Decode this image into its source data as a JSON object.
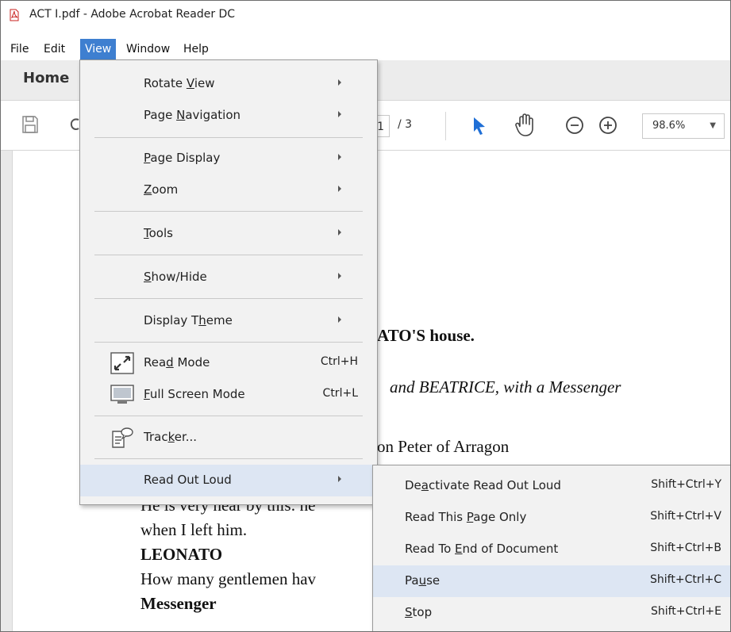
{
  "window": {
    "title": "ACT I.pdf - Adobe Acrobat Reader DC"
  },
  "menubar": {
    "file": "File",
    "edit": "Edit",
    "view": "View",
    "window": "Window",
    "help": "Help"
  },
  "tabs": {
    "home": "Home"
  },
  "toolbar": {
    "current_page": "1",
    "total_pages": "/ 3",
    "zoom": "98.6%",
    "icons": [
      "save-icon",
      "cloud-icon",
      "select-arrow-icon",
      "hand-icon",
      "zoom-out-icon",
      "zoom-in-icon",
      "chevron-down-icon"
    ]
  },
  "document": {
    "lines": [
      {
        "text": "ATO'S house.",
        "style": "bold"
      },
      {
        "text": "and BEATRICE, with a Messenger",
        "style": "italic"
      },
      {
        "text": "on Peter of Arragon",
        "style": "normal"
      },
      {
        "text": "He is very near by this: he",
        "style": "normal"
      },
      {
        "text": "when I left him.",
        "style": "normal"
      },
      {
        "text": "LEONATO",
        "style": "bold"
      },
      {
        "text": "How many gentlemen hav",
        "style": "normal"
      },
      {
        "text": "Messenger",
        "style": "bold"
      }
    ]
  },
  "view_menu": {
    "items": [
      {
        "pre": "Rotate ",
        "u": "V",
        "post": "iew",
        "shortcut": "",
        "submenu": true
      },
      {
        "pre": "Page ",
        "u": "N",
        "post": "avigation",
        "shortcut": "",
        "submenu": true
      },
      {
        "pre": "",
        "u": "P",
        "post": "age Display",
        "shortcut": "",
        "submenu": true
      },
      {
        "pre": "",
        "u": "Z",
        "post": "oom",
        "shortcut": "",
        "submenu": true
      },
      {
        "pre": "",
        "u": "T",
        "post": "ools",
        "shortcut": "",
        "submenu": true
      },
      {
        "pre": "",
        "u": "S",
        "post": "how/Hide",
        "shortcut": "",
        "submenu": true
      },
      {
        "pre": "Display T",
        "u": "h",
        "post": "eme",
        "shortcut": "",
        "submenu": true
      },
      {
        "pre": "Rea",
        "u": "d",
        "post": " Mode",
        "shortcut": "Ctrl+H",
        "submenu": false
      },
      {
        "pre": "",
        "u": "F",
        "post": "ull Screen Mode",
        "shortcut": "Ctrl+L",
        "submenu": false
      },
      {
        "pre": "Trac",
        "u": "k",
        "post": "er...",
        "shortcut": "",
        "submenu": false
      },
      {
        "pre": "Read Out Loud",
        "u": "",
        "post": "",
        "shortcut": "",
        "submenu": true
      }
    ]
  },
  "read_out_loud_menu": {
    "items": [
      {
        "pre": "De",
        "u": "a",
        "post": "ctivate Read Out Loud",
        "shortcut": "Shift+Ctrl+Y"
      },
      {
        "pre": "Read This ",
        "u": "P",
        "post": "age Only",
        "shortcut": "Shift+Ctrl+V"
      },
      {
        "pre": "Read To ",
        "u": "E",
        "post": "nd of Document",
        "shortcut": "Shift+Ctrl+B"
      },
      {
        "pre": "Pa",
        "u": "u",
        "post": "se",
        "shortcut": "Shift+Ctrl+C"
      },
      {
        "pre": "",
        "u": "S",
        "post": "top",
        "shortcut": "Shift+Ctrl+E"
      }
    ]
  },
  "colors": {
    "menu_active": "#3e7fd0",
    "menu_highlight": "#dde6f3",
    "select_arrow": "#1f6fd6"
  }
}
